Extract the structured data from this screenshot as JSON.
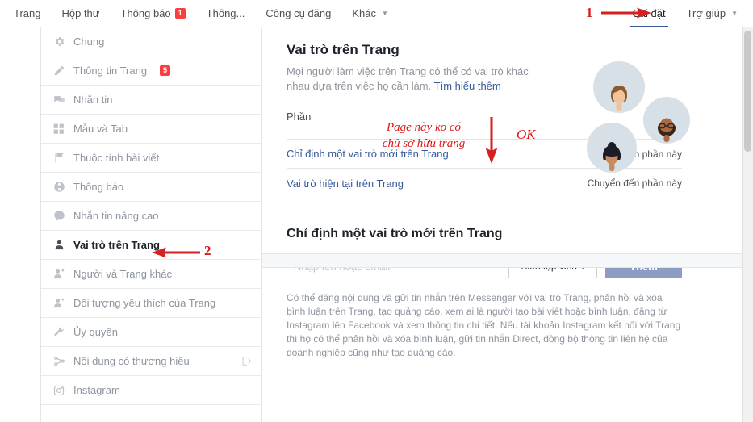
{
  "topnav": {
    "left_items": [
      {
        "label": "Trang",
        "icon": "",
        "badge": null,
        "caret": false,
        "active": false
      },
      {
        "label": "Hộp thư",
        "icon": "",
        "badge": null,
        "caret": false,
        "active": false
      },
      {
        "label": "Thông báo",
        "icon": "",
        "badge": "1",
        "caret": false,
        "active": false
      },
      {
        "label": "Thông...",
        "icon": "",
        "badge": null,
        "caret": false,
        "active": false
      },
      {
        "label": "Công cụ đăng",
        "icon": "",
        "badge": null,
        "caret": false,
        "active": false
      },
      {
        "label": "Khác",
        "icon": "",
        "badge": null,
        "caret": true,
        "active": false
      }
    ],
    "right_items": [
      {
        "label": "Cài đặt",
        "badge": null,
        "caret": false,
        "active": true
      },
      {
        "label": "Trợ giúp",
        "badge": null,
        "caret": true,
        "active": false
      }
    ]
  },
  "sidebar": {
    "items": [
      {
        "label": "Chung",
        "icon": "gear-icon",
        "badge": null,
        "active": false,
        "right_icon": null
      },
      {
        "label": "Thông tin Trang",
        "icon": "pencil-icon",
        "badge": "5",
        "active": false,
        "right_icon": null
      },
      {
        "label": "Nhắn tin",
        "icon": "chat-bubbles-icon",
        "badge": null,
        "active": false,
        "right_icon": null
      },
      {
        "label": "Mẫu và Tab",
        "icon": "grid-icon",
        "badge": null,
        "active": false,
        "right_icon": null
      },
      {
        "label": "Thuộc tính bài viết",
        "icon": "flag-icon",
        "badge": null,
        "active": false,
        "right_icon": null
      },
      {
        "label": "Thông báo",
        "icon": "globe-icon",
        "badge": null,
        "active": false,
        "right_icon": null
      },
      {
        "label": "Nhắn tin nâng cao",
        "icon": "speech-bubble-icon",
        "badge": null,
        "active": false,
        "right_icon": null
      },
      {
        "label": "Vai trò trên Trang",
        "icon": "person-icon",
        "badge": null,
        "active": true,
        "right_icon": null
      },
      {
        "label": "Người và Trang khác",
        "icon": "person-add-icon",
        "badge": null,
        "active": false,
        "right_icon": null
      },
      {
        "label": "Đối tượng yêu thích của Trang",
        "icon": "person-add-icon",
        "badge": null,
        "active": false,
        "right_icon": null
      },
      {
        "label": "Ủy quyền",
        "icon": "wrench-icon",
        "badge": null,
        "active": false,
        "right_icon": null
      },
      {
        "label": "Nội dung có thương hiệu",
        "icon": "share-branch-icon",
        "badge": null,
        "active": false,
        "right_icon": "external-link-icon"
      },
      {
        "label": "Instagram",
        "icon": "instagram-icon",
        "badge": null,
        "active": false,
        "right_icon": null
      }
    ]
  },
  "main": {
    "title": "Vai trò trên Trang",
    "subtext": "Mọi người làm việc trên Trang có thể có vai trò khác nhau dựa trên việc họ cần làm.",
    "subtext_link": "Tìm hiểu thêm",
    "phan_label": "Phần",
    "section_links": [
      {
        "label": "Chỉ định một vai trò mới trên Trang",
        "goto": "Chuyển đến phần này"
      },
      {
        "label": "Vai trò hiện tại trên Trang",
        "goto": "Chuyển đến phần này"
      }
    ],
    "assign": {
      "title": "Chỉ định một vai trò mới trên Trang",
      "input_value": "",
      "input_placeholder": "Nhập tên hoặc email",
      "role_selected": "Biên tập viên",
      "add_button": "Thêm",
      "description": "Có thể đăng nội dung và gửi tin nhắn trên Messenger với vai trò Trang, phản hồi và xóa bình luận trên Trang, tạo quảng cáo, xem ai là người tạo bài viết hoặc bình luận, đăng từ Instagram lên Facebook và xem thông tin chi tiết. Nếu tài khoản Instagram kết nối với Trang thì họ có thể phản hồi và xóa bình luận, gửi tin nhắn Direct, đồng bộ thông tin liên hệ của doanh nghiệp cũng như tạo quảng cáo."
    }
  },
  "annotations": {
    "marker_1": "1",
    "marker_2": "2",
    "note_line1": "Page này ko có",
    "note_line2": "chủ sở hữu trang",
    "ok": "OK"
  },
  "colors": {
    "accent_blue": "#365899",
    "link_blue": "#365899",
    "badge_red": "#fa3e3e",
    "annotation_red": "#e01616",
    "button_blue": "#8b9dc3",
    "avatar_bg": "#d6e0e6"
  }
}
